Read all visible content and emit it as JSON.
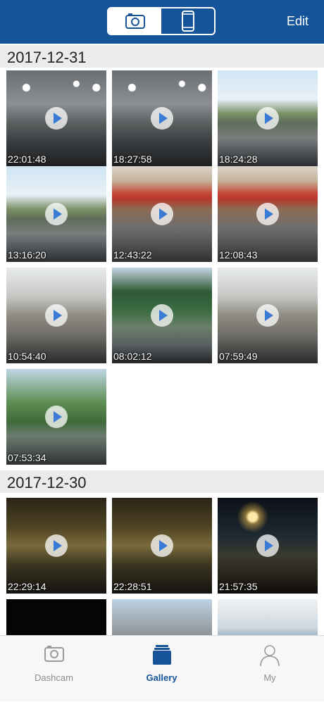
{
  "header": {
    "segments": [
      {
        "icon": "camera-icon",
        "active": true
      },
      {
        "icon": "phone-icon",
        "active": false
      }
    ],
    "edit_label": "Edit",
    "accent_color": "#16549a"
  },
  "sections": [
    {
      "date": "2017-12-31",
      "items": [
        {
          "time": "22:01:48",
          "scene": "garage"
        },
        {
          "time": "18:27:58",
          "scene": "garage"
        },
        {
          "time": "18:24:28",
          "scene": "street"
        },
        {
          "time": "13:16:20",
          "scene": "street"
        },
        {
          "time": "12:43:22",
          "scene": "shop"
        },
        {
          "time": "12:08:43",
          "scene": "shop"
        },
        {
          "time": "10:54:40",
          "scene": "house"
        },
        {
          "time": "08:02:12",
          "scene": "trees"
        },
        {
          "time": "07:59:49",
          "scene": "house"
        },
        {
          "time": "07:53:34",
          "scene": "dusk-palm"
        }
      ]
    },
    {
      "date": "2017-12-30",
      "items": [
        {
          "time": "22:29:14",
          "scene": "night-gate"
        },
        {
          "time": "22:28:51",
          "scene": "night-gate"
        },
        {
          "time": "21:57:35",
          "scene": "night-road"
        },
        {
          "time": "",
          "scene": "dark"
        },
        {
          "time": "",
          "scene": "day-partial"
        },
        {
          "time": "",
          "scene": "blue-house"
        }
      ]
    }
  ],
  "tabbar": {
    "tabs": [
      {
        "label": "Dashcam",
        "icon": "camera-icon",
        "active": false
      },
      {
        "label": "Gallery",
        "icon": "gallery-icon",
        "active": true
      },
      {
        "label": "My",
        "icon": "person-icon",
        "active": false
      }
    ]
  }
}
